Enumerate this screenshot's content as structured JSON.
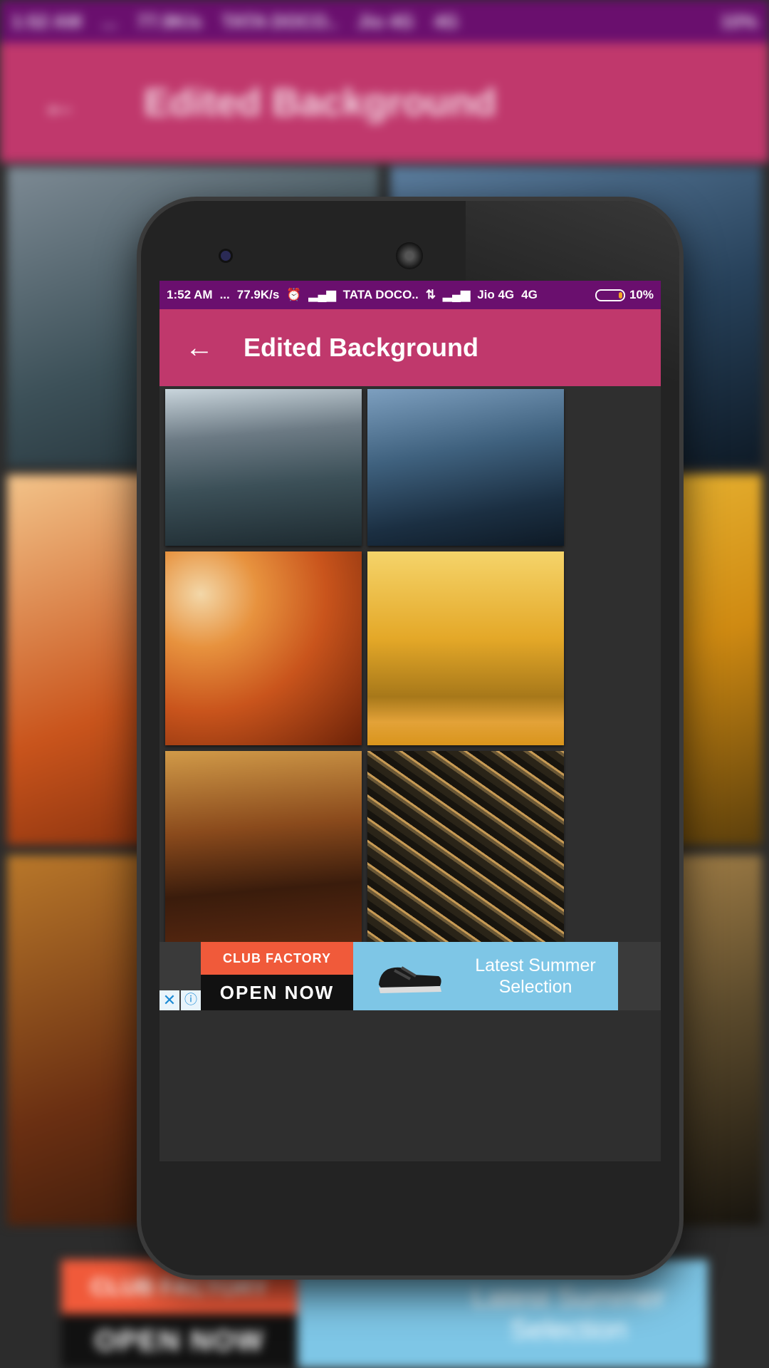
{
  "status_bar": {
    "time": "1:52 AM",
    "dots": "...",
    "speed": "77.9K/s",
    "carrier1": "TATA DOCO..",
    "carrier2": "Jio 4G",
    "network": "4G",
    "battery": "10%"
  },
  "background_status_bar": {
    "time": "1:52 AM",
    "dots": "...",
    "speed": "77.9K/s",
    "carrier1": "TATA DOCO..",
    "carrier2": "Jio 4G",
    "network": "4G",
    "battery": "10%"
  },
  "toolbar": {
    "title": "Edited Background",
    "back_icon": "arrow-left-icon"
  },
  "gallery": {
    "items": [
      {
        "name": "city-street",
        "colors": [
          "#7d8a94",
          "#3c5058",
          "#1d2a30"
        ]
      },
      {
        "name": "dark-tree-house",
        "colors": [
          "#5d7fa0",
          "#27415a",
          "#0e1a26"
        ]
      },
      {
        "name": "autumn-railway",
        "colors": [
          "#f3c48a",
          "#c9541c",
          "#6b2208"
        ]
      },
      {
        "name": "yellow-bokeh",
        "colors": [
          "#f2c540",
          "#cf8a12",
          "#5a3e0c"
        ]
      },
      {
        "name": "autumn-forest",
        "colors": [
          "#b9782a",
          "#6a2f12",
          "#2c1409"
        ]
      },
      {
        "name": "tangled-branches",
        "colors": [
          "#c79a54",
          "#5b4a2c",
          "#17140e"
        ]
      }
    ]
  },
  "ad": {
    "brand_top": "CLUB FACTORY",
    "brand_bottom": "OPEN NOW",
    "promo_line1": "Latest Summer",
    "promo_line2": "Selection",
    "close_icon": "✕",
    "info_icon": "ⓘ"
  },
  "background_ad": {
    "brand_top": "CLUB FACTORY",
    "brand_bottom": "OPEN NOW",
    "promo_line1": "Latest Summer",
    "promo_line2": "Selection"
  },
  "colors": {
    "status_bar": "#6a0f6e",
    "toolbar": "#c0386c",
    "ad_red": "#f05a3a",
    "ad_blue": "#7ec6e6"
  }
}
